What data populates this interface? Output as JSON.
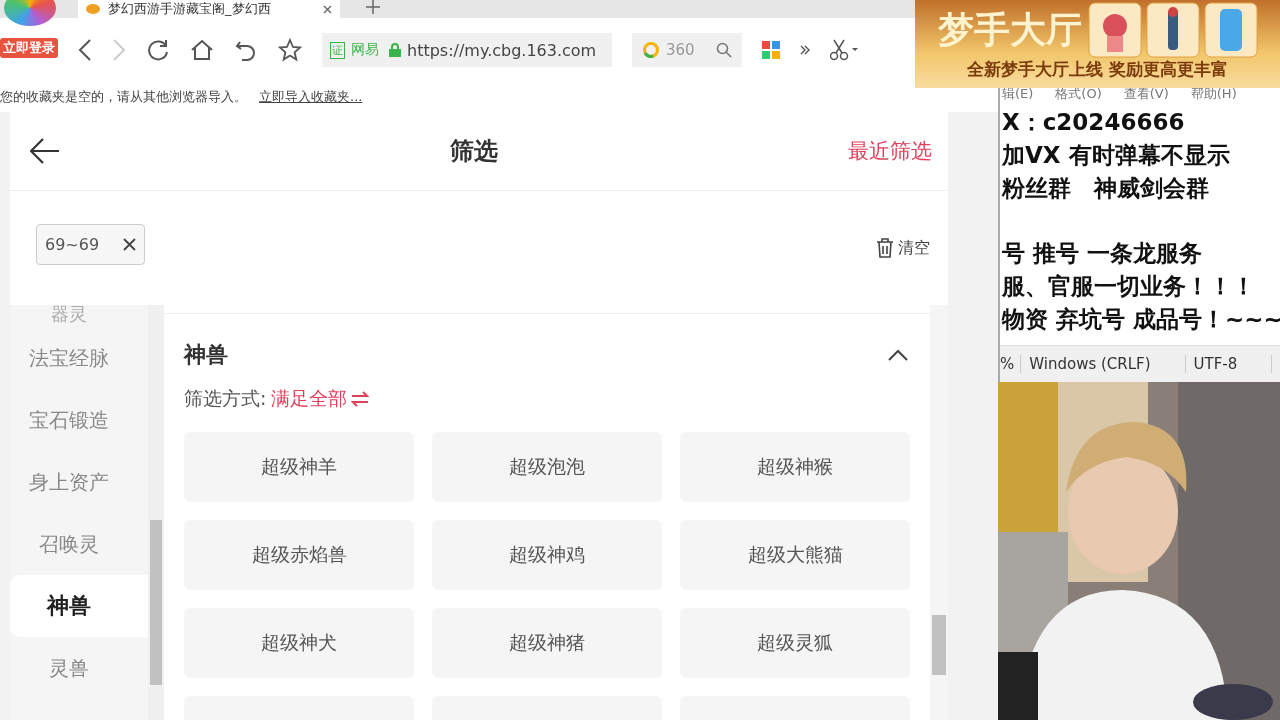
{
  "browser": {
    "tab": {
      "title": "梦幻西游手游藏宝阁_梦幻西"
    },
    "login_badge": "立即登录",
    "address": {
      "certificate_label": "证",
      "security_label": "网易",
      "url": "https://my.cbg.163.com"
    },
    "search": {
      "value": "360"
    },
    "bookmarks_bar": {
      "message": "您的收藏夹是空的，请从其他浏览器导入。",
      "link": "立即导入收藏夹..."
    }
  },
  "page": {
    "title": "筛选",
    "recent_link": "最近筛选",
    "chips": [
      {
        "label": "69~69"
      }
    ],
    "clear": "清空",
    "categories": [
      {
        "label": "器灵",
        "selected": false
      },
      {
        "label": "法宝经脉",
        "selected": false
      },
      {
        "label": "宝石锻造",
        "selected": false
      },
      {
        "label": "身上资产",
        "selected": false
      },
      {
        "label": "召唤灵",
        "selected": false
      },
      {
        "label": "神兽",
        "selected": true
      },
      {
        "label": "灵兽",
        "selected": false
      }
    ],
    "section": {
      "title": "神兽",
      "expanded": true,
      "mode_label": "筛选方式:",
      "mode_value": "满足全部",
      "options": [
        {
          "label": "超级神羊",
          "selected": false
        },
        {
          "label": "超级泡泡",
          "selected": false
        },
        {
          "label": "超级神猴",
          "selected": false
        },
        {
          "label": "超级赤焰兽",
          "selected": false
        },
        {
          "label": "超级神鸡",
          "selected": false
        },
        {
          "label": "超级大熊猫",
          "selected": false
        },
        {
          "label": "超级神犬",
          "selected": false
        },
        {
          "label": "超级神猪",
          "selected": false
        },
        {
          "label": "超级灵狐",
          "selected": false
        }
      ]
    }
  },
  "ad_banner": {
    "title": "梦手大厅",
    "subtitle": "全新梦手大厅上线 奖励更高更丰富"
  },
  "editor": {
    "menu": [
      "辑(E)",
      "格式(O)",
      "查看(V)",
      "帮助(H)"
    ],
    "lines": [
      "X：c20246666",
      "加VX 有时弹幕不显示",
      "粉丝群　神威剑会群",
      "号 推号 一条龙服务",
      "服、官服一切业务！！！",
      "物资 弃坑号 成品号！~~~"
    ],
    "status": [
      "%",
      "Windows (CRLF)",
      "UTF-8"
    ]
  }
}
